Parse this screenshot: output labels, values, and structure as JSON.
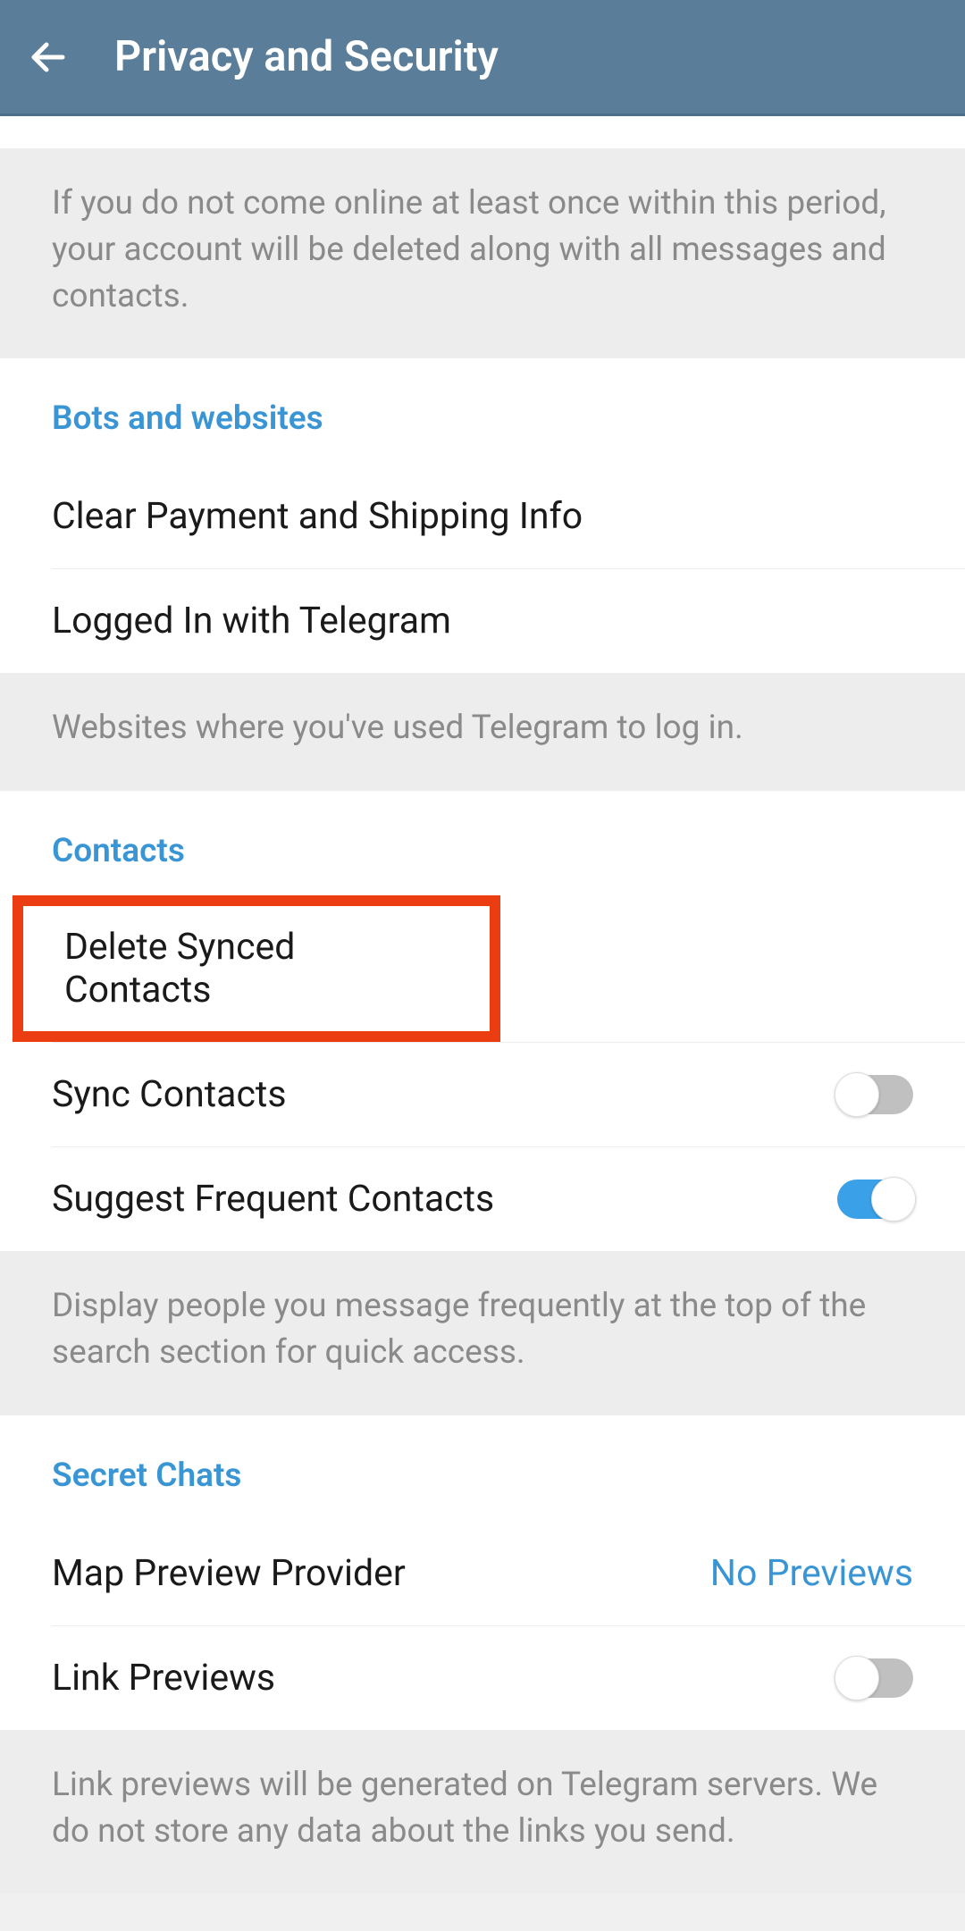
{
  "header": {
    "title": "Privacy and Security"
  },
  "topDescription": "If you do not come online at least once within this period, your account will be deleted along with all messages and contacts.",
  "sections": {
    "bots": {
      "header": "Bots and websites",
      "clearPayment": "Clear Payment and Shipping Info",
      "loggedIn": "Logged In with Telegram",
      "footer": "Websites where you've used Telegram to log in."
    },
    "contacts": {
      "header": "Contacts",
      "deleteSynced": "Delete Synced Contacts",
      "syncContacts": "Sync Contacts",
      "suggestFrequent": "Suggest Frequent Contacts",
      "footer": "Display people you message frequently at the top of the search section for quick access."
    },
    "secretChats": {
      "header": "Secret Chats",
      "mapPreview": "Map Preview Provider",
      "mapPreviewValue": "No Previews",
      "linkPreviews": "Link Previews",
      "footer": "Link previews will be generated on Telegram servers. We do not store any data about the links you send."
    }
  }
}
